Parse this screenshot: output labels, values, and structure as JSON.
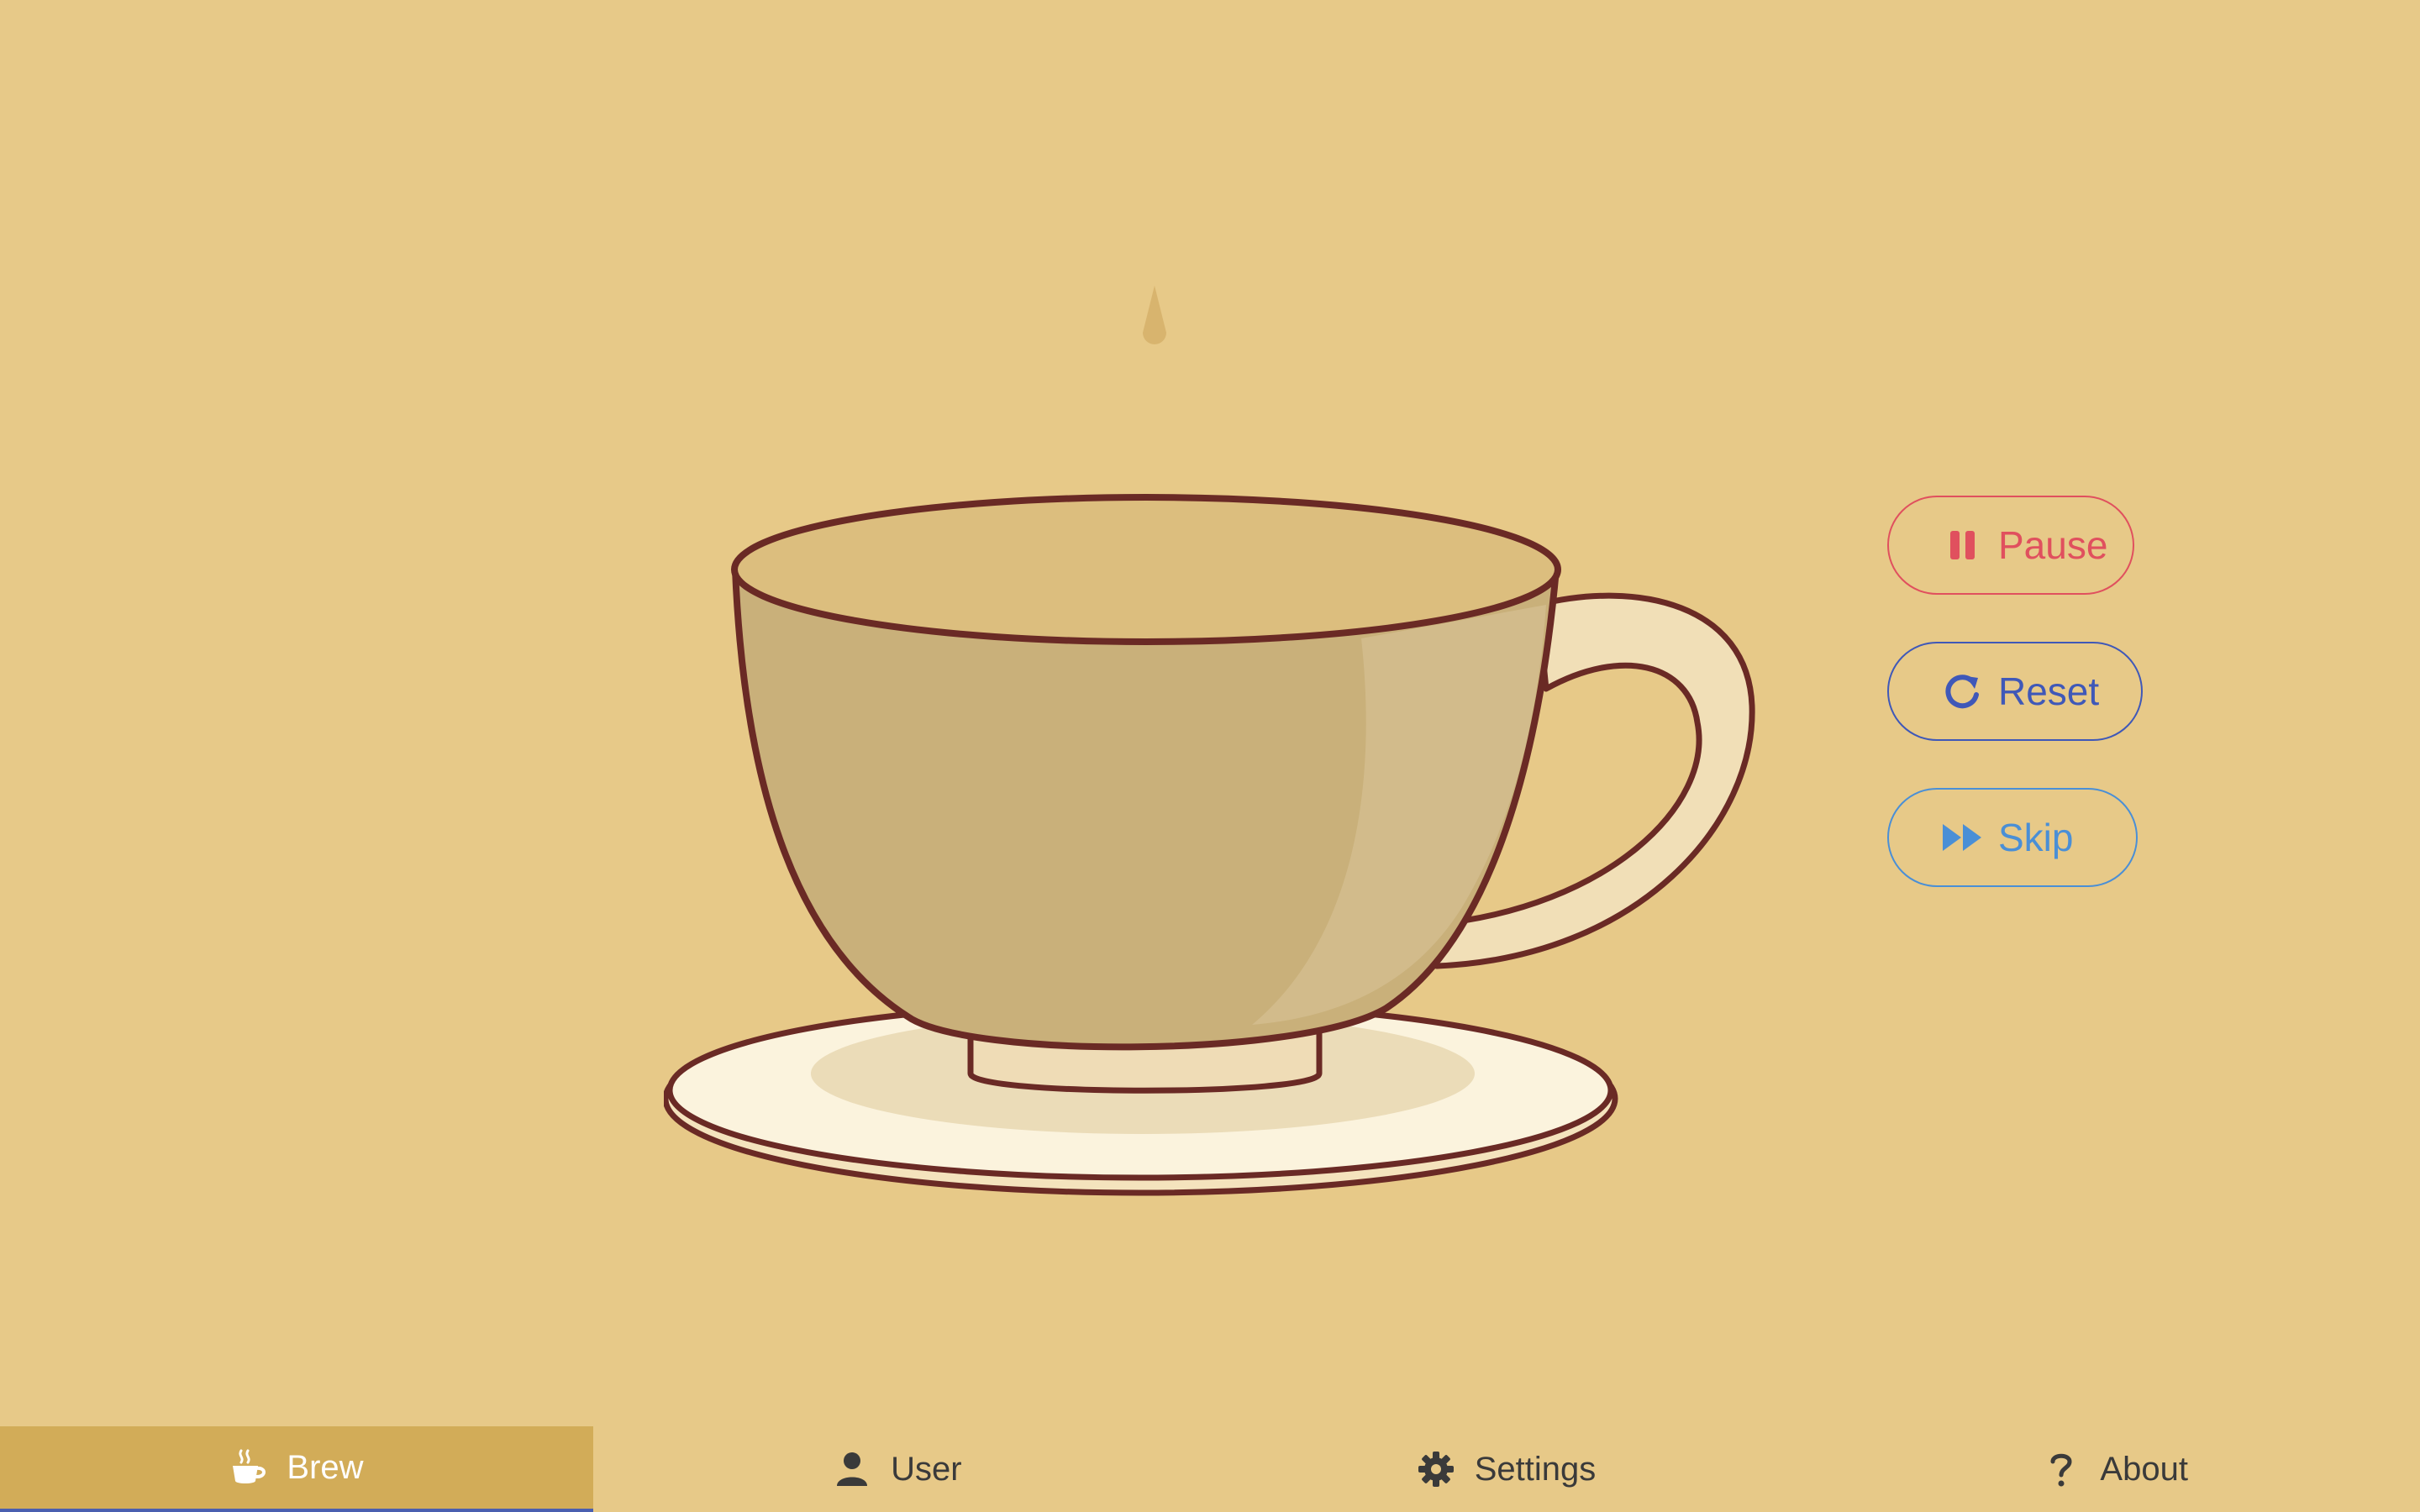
{
  "theme": {
    "background": "#e7c988",
    "active_tab": "#d2ac58",
    "pause_color": "#e0505e",
    "reset_color": "#3f58b8",
    "skip_color": "#4a8fd6"
  },
  "controls": {
    "pause": {
      "label": "Pause",
      "icon": "pause-icon"
    },
    "reset": {
      "label": "Reset",
      "icon": "reset-icon"
    },
    "skip": {
      "label": "Skip",
      "icon": "fast-forward-icon"
    }
  },
  "tabs": [
    {
      "label": "Brew",
      "icon": "coffee-cup-icon",
      "active": true
    },
    {
      "label": "User",
      "icon": "user-icon",
      "active": false
    },
    {
      "label": "Settings",
      "icon": "gear-icon",
      "active": false
    },
    {
      "label": "About",
      "icon": "question-icon",
      "active": false
    }
  ]
}
